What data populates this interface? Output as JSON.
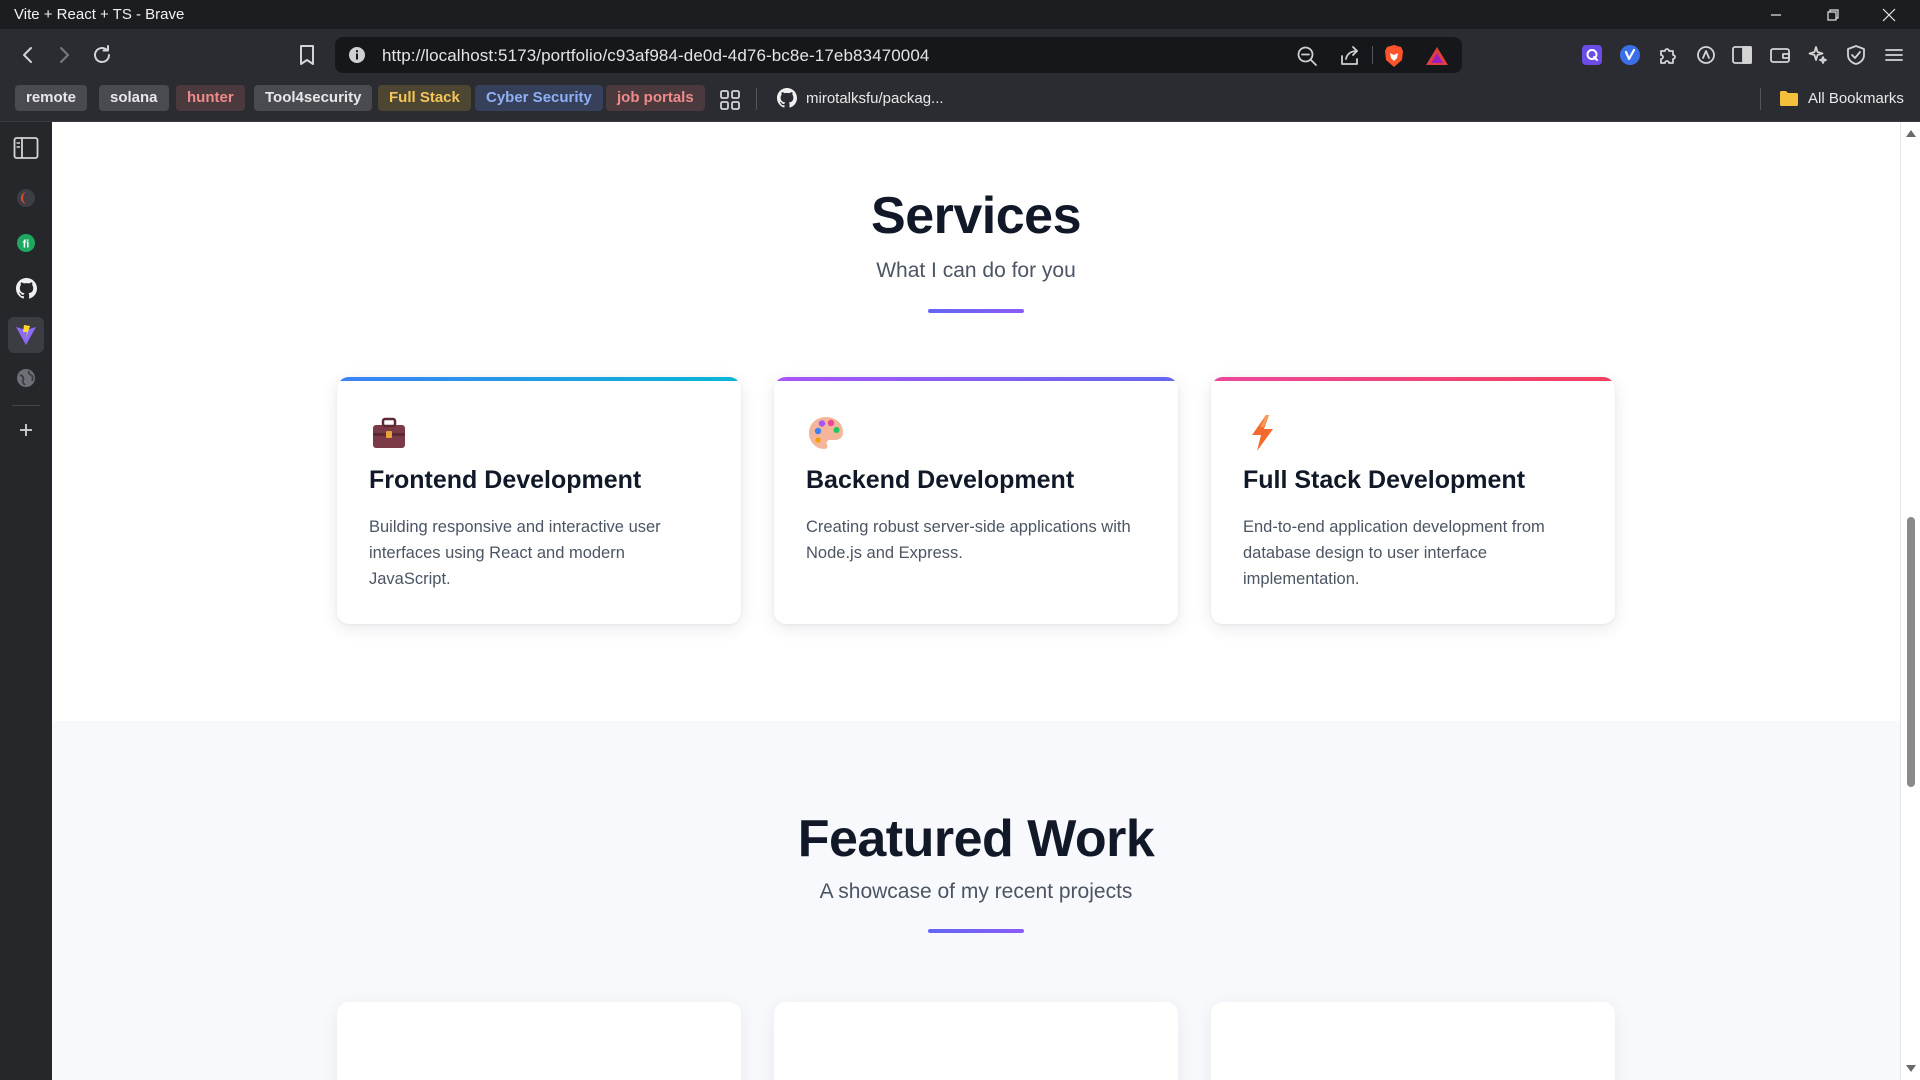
{
  "window": {
    "title": "Vite + React + TS - Brave",
    "controls": [
      "minimize",
      "restore",
      "close"
    ]
  },
  "browser": {
    "url": "http://localhost:5173/portfolio/c93af984-de0d-4d76-bc8e-17eb83470004",
    "nav": [
      "back-icon",
      "forward-icon",
      "reload-icon",
      "bookmark-icon"
    ],
    "url_icons": [
      "zoom-out-icon",
      "share-icon",
      "brave-shields-icon",
      "brave-rewards-icon"
    ],
    "extensions": [
      "extension-q-icon",
      "extension-v-icon",
      "puzzle-icon",
      "leo-icon",
      "sidebar-toggle-icon",
      "wallet-icon",
      "leo-ai-icon",
      "vpn-shield-icon",
      "menu-icon"
    ]
  },
  "bookmarks": {
    "tags": [
      {
        "label": "remote",
        "bg": "#4a4b50",
        "color": "#e8e8ea"
      },
      {
        "label": "solana",
        "bg": "#4a4b50",
        "color": "#e8e8ea"
      },
      {
        "label": "hunter",
        "bg": "#4a3a3e",
        "color": "#f08a8a"
      },
      {
        "label": "Tool4security",
        "bg": "#4a4b50",
        "color": "#e8e8ea"
      },
      {
        "label": "Full Stack",
        "bg": "#4d4632",
        "color": "#f3c55a"
      },
      {
        "label": "Cyber Security",
        "bg": "#36405a",
        "color": "#8fb0f5"
      },
      {
        "label": "job portals",
        "bg": "#4a3a3e",
        "color": "#f08a8a"
      }
    ],
    "github_link": "mirotalksfu/packag...",
    "all_bookmarks": "All Bookmarks"
  },
  "sidebar": {
    "items": [
      "sidebar-panel-icon",
      "brave-talk-icon",
      "app-green-icon",
      "github-icon",
      "vite-icon",
      "globe-icon",
      "add-icon"
    ]
  },
  "services": {
    "title": "Services",
    "subtitle": "What I can do for you",
    "cards": [
      {
        "icon": "briefcase-icon",
        "accent": "linear-gradient(90deg, #3b82f6, #06b6d4)",
        "title": "Frontend Development",
        "description": "Building responsive and interactive user interfaces using React and modern JavaScript."
      },
      {
        "icon": "palette-icon",
        "accent": "linear-gradient(90deg, #a855f7, #6366f1)",
        "title": "Backend Development",
        "description": "Creating robust server-side applications with Node.js and Express."
      },
      {
        "icon": "lightning-icon",
        "accent": "linear-gradient(90deg, #ec4899, #f43f5e)",
        "title": "Full Stack Development",
        "description": "End-to-end application development from database design to user interface implementation."
      }
    ]
  },
  "featured": {
    "title": "Featured Work",
    "subtitle": "A showcase of my recent projects"
  },
  "colors": {
    "heading": "#111827",
    "body_text": "#4b5563",
    "divider_gradient_start": "#6366f1",
    "divider_gradient_end": "#8b5cf6",
    "featured_bg": "#f7f9fc"
  }
}
